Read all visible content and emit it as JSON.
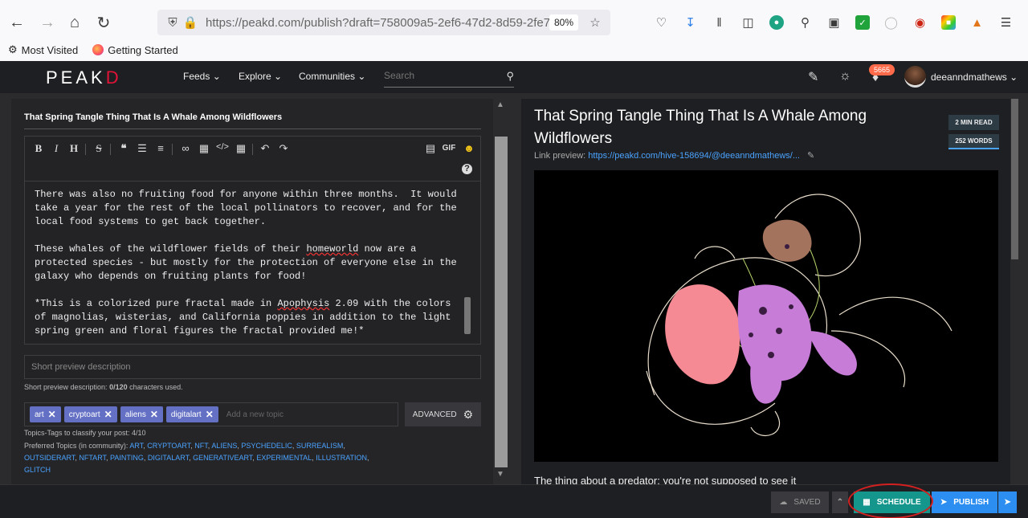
{
  "browser": {
    "url": "https://peakd.com/publish?draft=758009a5-2ef6-47d2-8d59-2fe7f7f",
    "zoom": "80%",
    "bookmarks": [
      {
        "label": "Most Visited"
      },
      {
        "label": "Getting Started"
      }
    ]
  },
  "site": {
    "logo_text": "PEAK",
    "logo_accent": "D",
    "nav": {
      "feeds": "Feeds",
      "explore": "Explore",
      "communities": "Communities"
    },
    "search_placeholder": "Search",
    "notification_count": "5665",
    "username": "deeanndmathews"
  },
  "editor": {
    "title": "That Spring Tangle Thing That Is A Whale Among Wildflowers",
    "toolbar": {
      "gif": "GIF"
    },
    "body": {
      "p1": "There was also no fruiting food for anyone within three months.  It would take a year for the rest of the local pollinators to recover, and for the local food systems to get back together.",
      "p2a": "These whales of the wildflower fields of their ",
      "p2u": "homeworld",
      "p2b": " now are a protected species - but mostly for the protection of everyone else in the galaxy who depends on fruiting plants for food!",
      "p3a": "*This is a colorized pure fractal made in ",
      "p3u": "Apophysis",
      "p3b": " 2.09 with the colors of magnolias, wisterias, and California poppies in addition to the light spring green and floral figures the fractal provided me!*"
    },
    "short_desc_placeholder": "Short preview description",
    "short_desc_label": "Short preview description: ",
    "short_desc_count": "0/120",
    "short_desc_suffix": " characters used.",
    "tags": [
      "art",
      "cryptoart",
      "aliens",
      "digitalart"
    ],
    "new_topic_placeholder": "Add a new topic",
    "advanced_label": "ADVANCED",
    "topics_info": "Topics-Tags to classify your post: 4/10",
    "preferred_label": "Preferred Topics (in community): ",
    "preferred_topics": [
      "ART",
      "CRYPTOART",
      "NFT",
      "ALIENS",
      "PSYCHEDELIC",
      "SURREALISM",
      "OUTSIDERART",
      "NFTART",
      "PAINTING",
      "DIGITALART",
      "GENERATIVEART",
      "EXPERIMENTAL",
      "ILLUSTRATION",
      "GLITCH"
    ]
  },
  "preview": {
    "title": "That Spring Tangle Thing That Is A Whale Among Wildflowers",
    "read_time": "2 MIN READ",
    "word_count": "252 WORDS",
    "link_label": "Link preview: ",
    "link_url": "https://peakd.com/hive-158694/@deeanndmathews/...",
    "first_line": "The thing about a predator: you're not supposed to see it"
  },
  "footer": {
    "saved": "SAVED",
    "schedule": "SCHEDULE",
    "publish": "PUBLISH"
  },
  "colors": {
    "accent_red": "#e31337",
    "tag_bg": "#6370c4",
    "schedule_bg": "#14968c",
    "publish_bg": "#2b8ef0",
    "link": "#4aa3ff",
    "annotation": "#d42020"
  }
}
